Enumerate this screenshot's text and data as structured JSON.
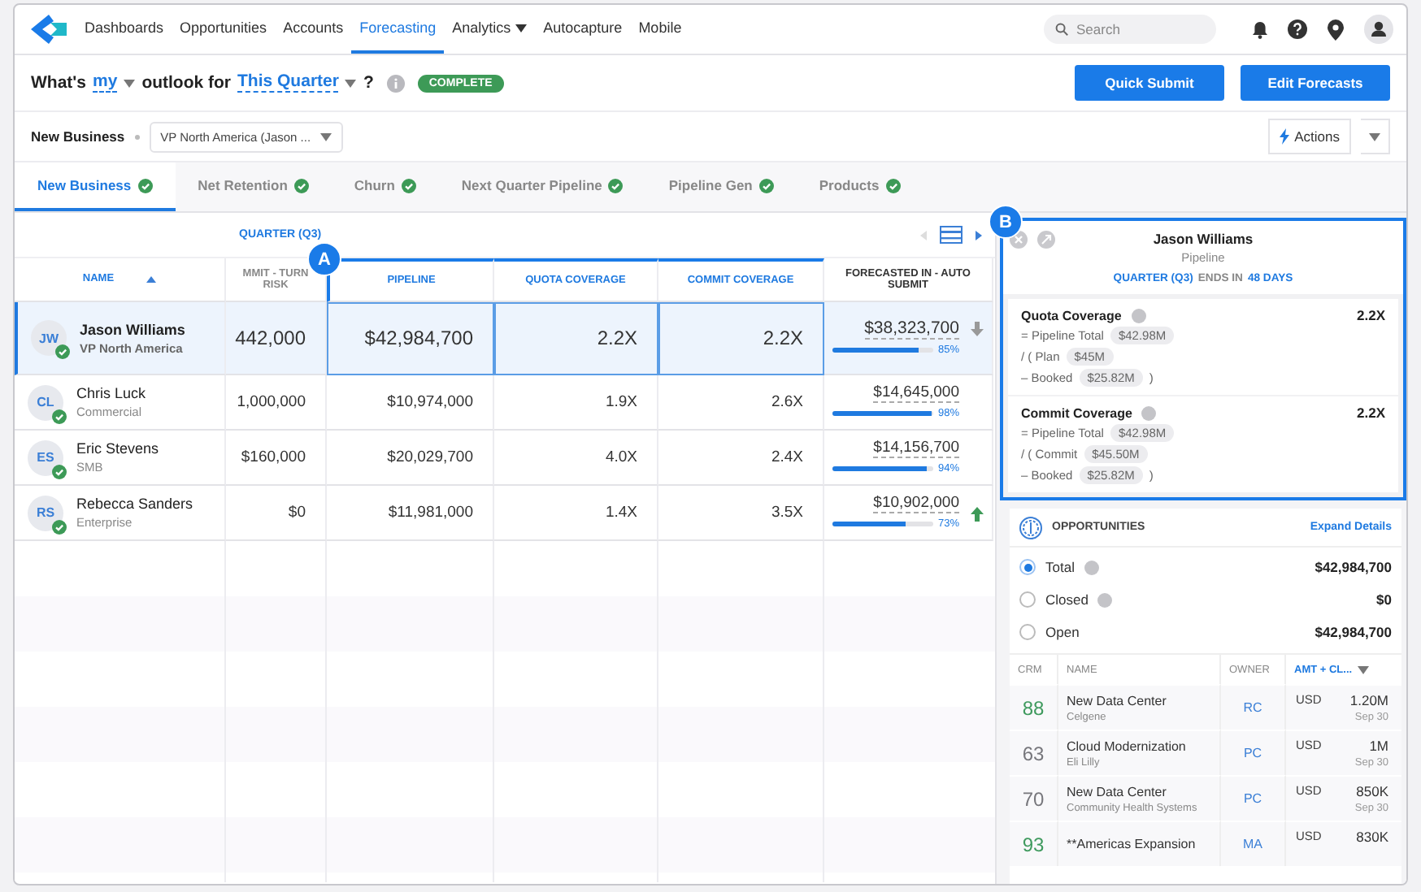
{
  "nav": {
    "items": [
      {
        "label": "Dashboards",
        "selected": false,
        "has_menu": false
      },
      {
        "label": "Opportunities",
        "selected": false,
        "has_menu": false
      },
      {
        "label": "Accounts",
        "selected": false,
        "has_menu": false
      },
      {
        "label": "Forecasting",
        "selected": true,
        "has_menu": false
      },
      {
        "label": "Analytics",
        "selected": false,
        "has_menu": true
      },
      {
        "label": "Autocapture",
        "selected": false,
        "has_menu": false
      },
      {
        "label": "Mobile",
        "selected": false,
        "has_menu": false
      }
    ],
    "search": {
      "placeholder": "Search"
    }
  },
  "outlook": {
    "prefix": "What's",
    "owner": "my",
    "middle": "outlook for",
    "period": "This Quarter",
    "suffix": "?",
    "status": "COMPLETE"
  },
  "buttons": [
    "Quick Submit",
    "Edit Forecasts"
  ],
  "filter": {
    "segment": "New Business",
    "hierarchy": "VP North America (Jason ...",
    "actions": "Actions"
  },
  "tabs": [
    {
      "label": "New Business",
      "selected": true,
      "complete": true
    },
    {
      "label": "Net Retention",
      "selected": false,
      "complete": true
    },
    {
      "label": "Churn",
      "selected": false,
      "complete": true
    },
    {
      "label": "Next Quarter Pipeline",
      "selected": false,
      "complete": true
    },
    {
      "label": "Pipeline Gen",
      "selected": false,
      "complete": true
    },
    {
      "label": "Products",
      "selected": false,
      "complete": true
    }
  ],
  "table": {
    "period": "QUARTER (Q3)",
    "columns": [
      {
        "label": "NAME",
        "highlighted": false,
        "sorted": true
      },
      {
        "label": "MMIT - TURN RISK",
        "highlighted": false,
        "sorted": false
      },
      {
        "label": "PIPELINE",
        "highlighted": true,
        "sorted": false
      },
      {
        "label": "QUOTA COVERAGE",
        "highlighted": true,
        "sorted": false
      },
      {
        "label": "COMMIT COVERAGE",
        "highlighted": true,
        "sorted": false
      },
      {
        "label": "FORECASTED IN - AUTO SUBMIT",
        "highlighted": false,
        "sorted": false
      }
    ],
    "rows": [
      {
        "initials": "JW",
        "name": "Jason Williams",
        "role": "VP North America",
        "approved": true,
        "selected": true,
        "commit": "442,000",
        "pipeline": "$42,984,700",
        "quota_coverage": "2.2X",
        "commit_coverage": "2.2X",
        "forecast": "$38,323,700",
        "level": 0.85,
        "percent": "85%",
        "rising": false
      },
      {
        "initials": "CL",
        "name": "Chris Luck",
        "role": "Commercial",
        "approved": true,
        "selected": false,
        "commit": "1,000,000",
        "pipeline": "$10,974,000",
        "quota_coverage": "1.9X",
        "commit_coverage": "2.6X",
        "forecast": "$14,645,000",
        "level": 0.98,
        "percent": "98%"
      },
      {
        "initials": "ES",
        "name": "Eric Stevens",
        "role": "SMB",
        "approved": true,
        "selected": false,
        "commit": "$160,000",
        "pipeline": "$20,029,700",
        "quota_coverage": "4.0X",
        "commit_coverage": "2.4X",
        "forecast": "$14,156,700",
        "level": 0.94,
        "percent": "94%"
      },
      {
        "initials": "RS",
        "name": "Rebecca Sanders",
        "role": "Enterprise",
        "approved": true,
        "selected": false,
        "commit": "$0",
        "pipeline": "$11,981,000",
        "quota_coverage": "1.4X",
        "commit_coverage": "3.5X",
        "forecast": "$10,902,000",
        "level": 0.73,
        "percent": "73%",
        "rising": true
      }
    ]
  },
  "callouts": [
    {
      "label": "A"
    },
    {
      "label": "B"
    }
  ],
  "panel": {
    "title": "Jason Williams",
    "subtitle": "Pipeline",
    "period": "QUARTER (Q3)",
    "ends_in": "ENDS IN",
    "days": "48 DAYS",
    "coverages": [
      {
        "title": "Quota Coverage",
        "info": true,
        "value": "2.2X",
        "lines": [
          {
            "prefix": "= Pipeline Total",
            "amount": "$42.98M"
          },
          {
            "prefix": "/ ( Plan",
            "amount": "$45M"
          },
          {
            "prefix": "– Booked",
            "amount": "$25.82M",
            "suffix": ")"
          }
        ]
      },
      {
        "title": "Commit Coverage",
        "info": true,
        "value": "2.2X",
        "lines": [
          {
            "prefix": "= Pipeline Total",
            "amount": "$42.98M"
          },
          {
            "prefix": "/ ( Commit",
            "amount": "$45.50M"
          },
          {
            "prefix": "– Booked",
            "amount": "$25.82M",
            "suffix": ")"
          }
        ]
      }
    ]
  },
  "opportunities": {
    "title": "OPPORTUNITIES",
    "link": "Expand Details",
    "filters": [
      {
        "label": "Total",
        "selected": true,
        "info": true,
        "amount": "$42,984,700"
      },
      {
        "label": "Closed",
        "selected": false,
        "info": true,
        "amount": "$0"
      },
      {
        "label": "Open",
        "selected": false,
        "amount": "$42,984,700"
      }
    ],
    "columns": [
      "CRM",
      "NAME",
      "OWNER",
      "AMT + CL..."
    ],
    "rows": [
      {
        "score": "88",
        "color": "#3f9a5e",
        "name": "New Data Center",
        "account": "Celgene",
        "owner": "RC",
        "currency": "USD",
        "amount": "1.20M",
        "date": "Sep 30"
      },
      {
        "score": "63",
        "color": "#77777c",
        "name": "Cloud Modernization",
        "account": "Eli Lilly",
        "owner": "PC",
        "currency": "USD",
        "amount": "1M",
        "date": "Sep 30"
      },
      {
        "score": "70",
        "color": "#77777c",
        "name": "New Data Center",
        "account": "Community Health Systems",
        "owner": "PC",
        "currency": "USD",
        "amount": "850K",
        "date": "Sep 30"
      },
      {
        "score": "93",
        "color": "#3f9a5e",
        "name": "**Americas Expansion",
        "owner": "MA",
        "currency": "USD",
        "amount": "830K"
      }
    ]
  }
}
